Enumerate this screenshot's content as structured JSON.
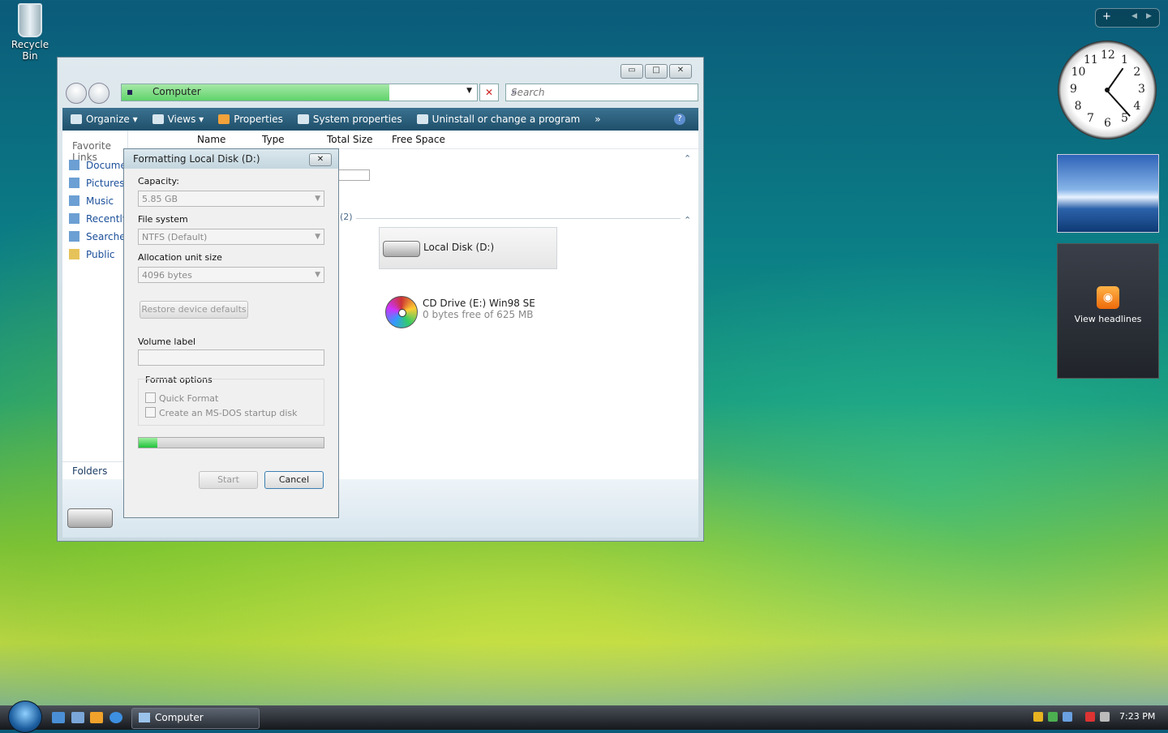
{
  "desktop": {
    "recycle_bin": "Recycle Bin"
  },
  "explorer": {
    "address": "Computer",
    "search_placeholder": "Search",
    "toolbar": {
      "organize": "Organize",
      "views": "Views",
      "properties": "Properties",
      "system_properties": "System properties",
      "uninstall": "Uninstall or change a program",
      "more": "»",
      "help": "?"
    },
    "nav": {
      "header": "Favorite Links",
      "items": [
        "Documents",
        "Pictures",
        "Music",
        "Recently Changed",
        "Searches",
        "Public"
      ],
      "folders": "Folders"
    },
    "columns": [
      "Name",
      "Type",
      "Total Size",
      "Free Space"
    ],
    "group_devices_count": "(2)",
    "drives": [
      {
        "name": "Local Disk (D:)"
      },
      {
        "name": "CD Drive (E:) Win98 SE",
        "sub": "0 bytes free of 625 MB"
      }
    ]
  },
  "format_dialog": {
    "title": "Formatting Local Disk (D:)",
    "capacity_label": "Capacity:",
    "capacity_value": "5.85 GB",
    "fs_label": "File system",
    "fs_value": "NTFS (Default)",
    "alloc_label": "Allocation unit size",
    "alloc_value": "4096 bytes",
    "restore_button": "Restore device defaults",
    "volume_label": "Volume label",
    "volume_value": "",
    "options_label": "Format options",
    "quick_format": "Quick Format",
    "msdos": "Create an MS-DOS startup disk",
    "progress": 0.1,
    "start_button": "Start",
    "cancel_button": "Cancel"
  },
  "gadgets": {
    "feed_label": "View headlines",
    "clock_numbers": [
      "12",
      "1",
      "2",
      "3",
      "4",
      "5",
      "6",
      "7",
      "8",
      "9",
      "10",
      "11"
    ]
  },
  "taskbar": {
    "window_button": "Computer",
    "clock": "7:23 PM"
  }
}
